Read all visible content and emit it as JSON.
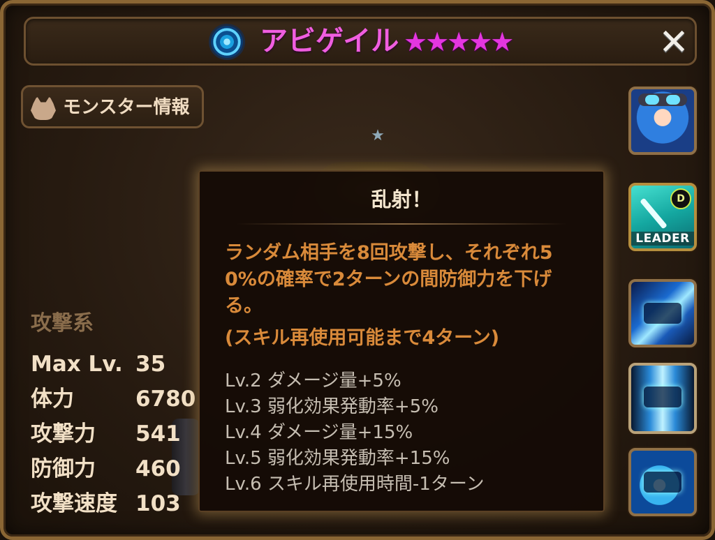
{
  "header": {
    "monster_name": "アビゲイル",
    "stars": "★★★★★",
    "star_count": 5,
    "element_icon": "wind-element-icon",
    "close_icon": "close-x-icon",
    "close_label": "✕"
  },
  "info_button": {
    "label": "モンスター情報",
    "icon": "monster-skull-icon"
  },
  "stats": {
    "category": "攻撃系",
    "rows": [
      {
        "label": "Max Lv.",
        "value": "35"
      },
      {
        "label": "体力",
        "value": "6780"
      },
      {
        "label": "攻撃力",
        "value": "541"
      },
      {
        "label": "防御力",
        "value": "460"
      },
      {
        "label": "攻撃速度",
        "value": "103"
      }
    ]
  },
  "tooltip": {
    "skill_name": "乱射！",
    "description": "ランダム相手を8回攻撃し、それぞれ5\n0%の確率で2ターンの間防御力を下げ\nる。",
    "cooldown": "(スキル再使用可能まで4ターン)",
    "levels": [
      "Lv.2 ダメージ量+5%",
      "Lv.3 弱化効果発動率+5%",
      "Lv.4 ダメージ量+15%",
      "Lv.5 弱化効果発動率+15%",
      "Lv.6 スキル再使用時間-1ターン"
    ]
  },
  "side_panel": {
    "portrait": "monster-portrait-icon",
    "leader_label": "LEADER",
    "leader_badge": "D",
    "skills": [
      "skill-1-icon",
      "skill-2-icon",
      "skill-3-icon"
    ]
  },
  "colors": {
    "name_pink": "#f05ee0",
    "desc_orange": "#d98a3a",
    "frame_gold": "#8a6634"
  }
}
